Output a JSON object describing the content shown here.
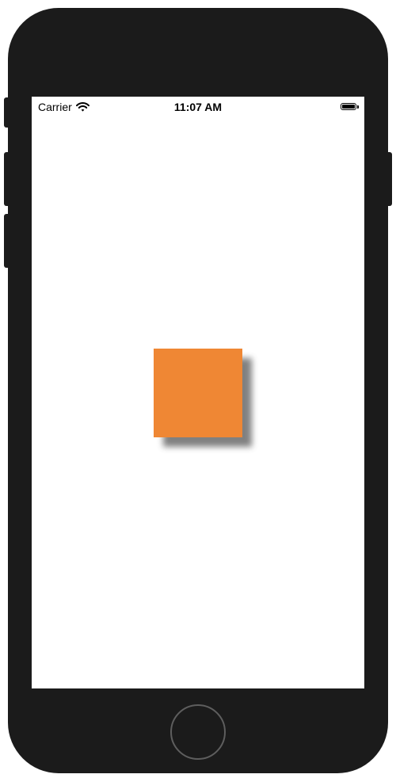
{
  "status_bar": {
    "carrier": "Carrier",
    "time": "11:07 AM",
    "wifi_icon": "wifi-icon",
    "battery_icon": "battery-icon"
  },
  "content": {
    "square_color": "#EF8734",
    "shadow_color": "#6B6B6B"
  },
  "colors": {
    "device_frame": "#1B1B1B",
    "screen_background": "#FFFFFF",
    "home_button_ring": "#5E5E5E"
  }
}
